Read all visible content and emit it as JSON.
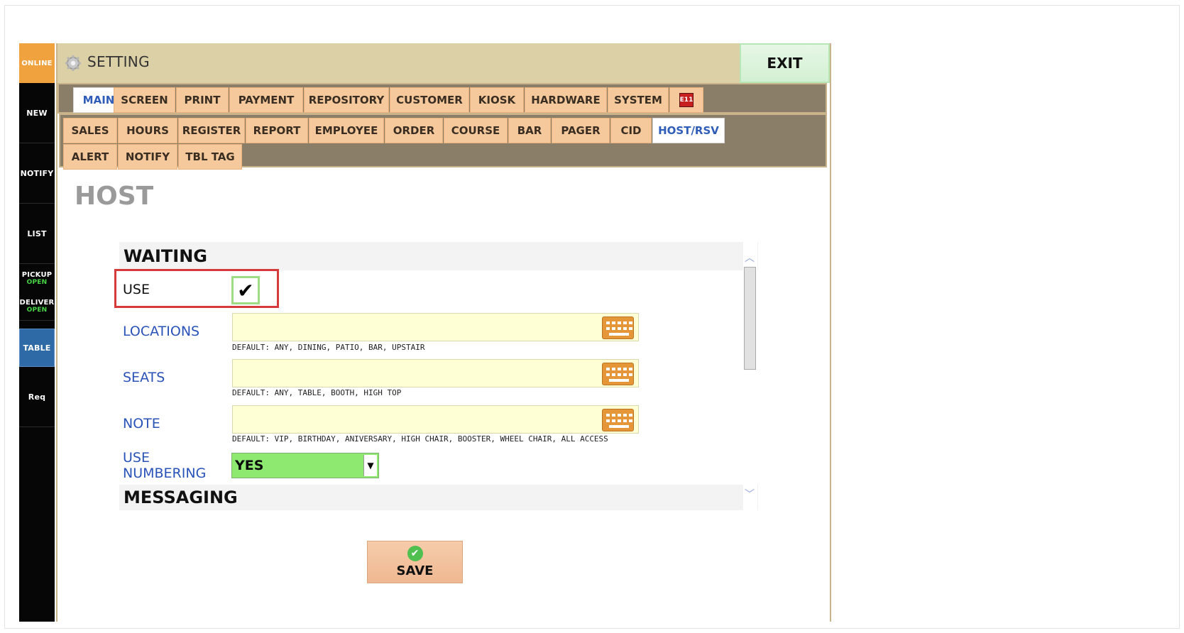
{
  "sidebar": {
    "online": "ONLINE",
    "new": "NEW",
    "notify": "NOTIFY",
    "list": "LIST",
    "pickup": "PICKUP",
    "pickup_status": "OPEN",
    "deliver": "DELIVER",
    "deliver_status": "OPEN",
    "table": "TABLE",
    "req": "Req"
  },
  "header": {
    "title": "SETTING",
    "exit": "EXIT"
  },
  "main_tabs": [
    "MAIN",
    "SCREEN",
    "PRINT",
    "PAYMENT",
    "REPOSITORY",
    "CUSTOMER",
    "KIOSK",
    "HARDWARE",
    "SYSTEM"
  ],
  "main_tab_badge": "E11",
  "sub_tabs_row1": [
    "SALES",
    "HOURS",
    "REGISTER",
    "REPORT",
    "EMPLOYEE",
    "ORDER",
    "COURSE",
    "BAR",
    "PAGER",
    "CID",
    "HOST/RSV"
  ],
  "sub_tabs_row2": [
    "ALERT",
    "NOTIFY",
    "TBL TAG"
  ],
  "page_title": "HOST",
  "waiting": {
    "heading": "WAITING",
    "use_label": "USE",
    "use_checked": "✔",
    "locations_label": "LOCATIONS",
    "locations_value": "",
    "locations_hint": "DEFAULT: ANY, DINING, PATIO, BAR, UPSTAIR",
    "seats_label": "SEATS",
    "seats_value": "",
    "seats_hint": "DEFAULT: ANY, TABLE, BOOTH, HIGH TOP",
    "note_label": "NOTE",
    "note_value": "",
    "note_hint": "DEFAULT: VIP, BIRTHDAY, ANIVERSARY, HIGH CHAIR, BOOSTER, WHEEL CHAIR, ALL ACCESS",
    "numbering_label_1": "USE",
    "numbering_label_2": "NUMBERING",
    "numbering_value": "YES"
  },
  "messaging": {
    "heading": "MESSAGING"
  },
  "save_label": "SAVE",
  "colors": {
    "sidebar_bg": "#060606",
    "online_bg": "#f0a23f",
    "topbar_bg": "#dcd0a7",
    "tab_bg": "#f5c99b",
    "active_tab_text": "#2f5db8",
    "field_bg": "#ffffd6",
    "select_bg": "#8ee970",
    "highlight_border": "#d73a3a"
  }
}
